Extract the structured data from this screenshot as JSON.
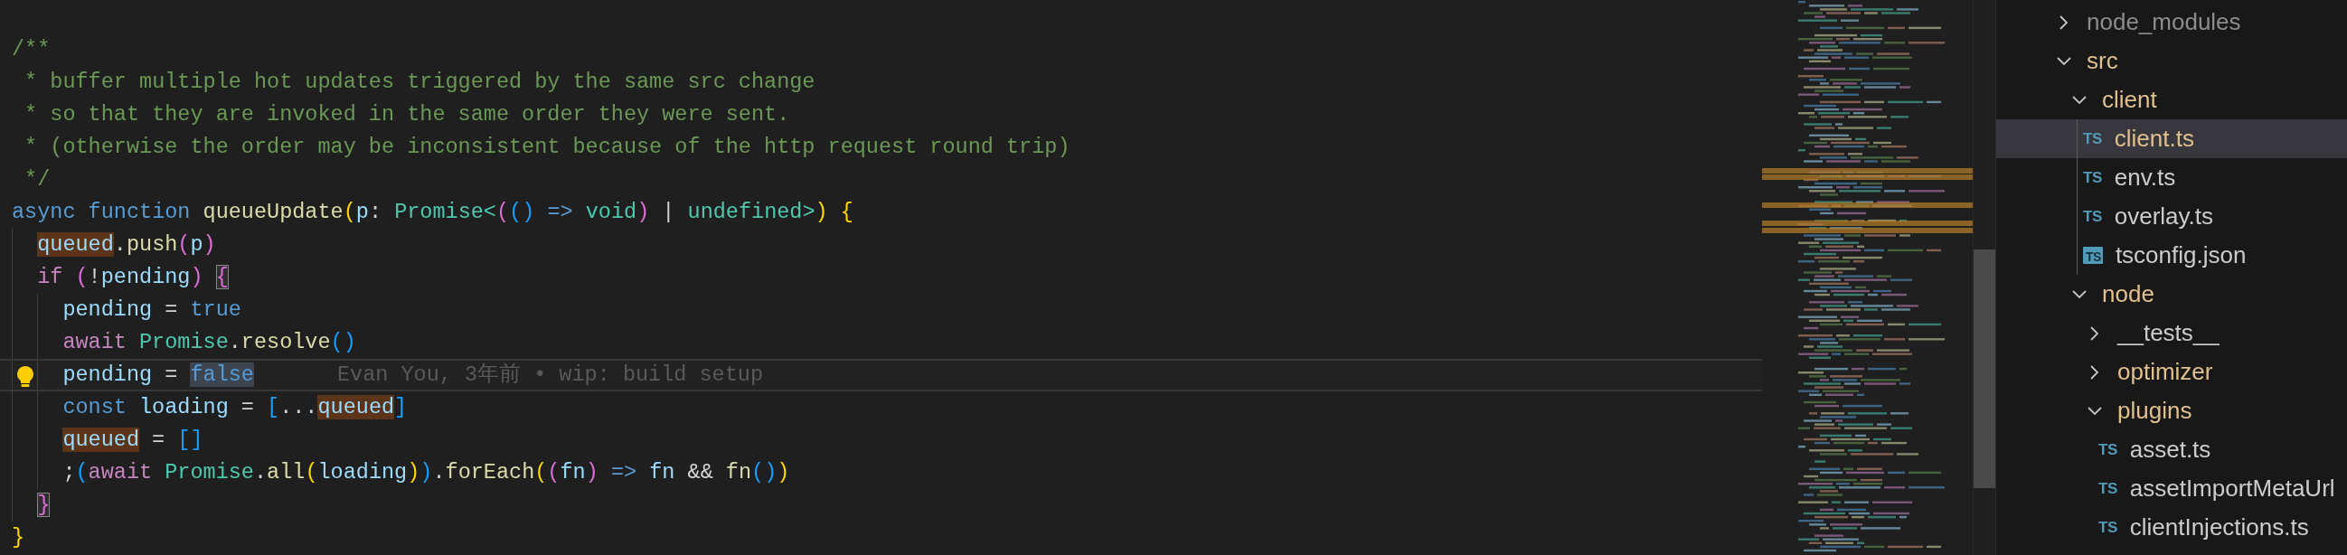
{
  "editor": {
    "lines": [
      {
        "current": false,
        "tokens": [
          {
            "text": "/**",
            "kind": "comment"
          }
        ]
      },
      {
        "current": false,
        "tokens": [
          {
            "text": " * buffer multiple hot updates triggered by the same src change",
            "kind": "comment"
          }
        ]
      },
      {
        "current": false,
        "tokens": [
          {
            "text": " * so that they are invoked in the same order they were sent.",
            "kind": "comment"
          }
        ]
      },
      {
        "current": false,
        "tokens": [
          {
            "text": " * (otherwise the order may be inconsistent because of the http request round trip)",
            "kind": "comment"
          }
        ]
      },
      {
        "current": false,
        "tokens": [
          {
            "text": " */",
            "kind": "comment"
          }
        ]
      },
      {
        "current": false,
        "tokens": [
          {
            "text": "async function ",
            "kind": "keyword"
          },
          {
            "text": "queueUpdate",
            "kind": "function"
          },
          {
            "text": "(",
            "kind": "bracket1"
          },
          {
            "text": "p",
            "kind": "variable"
          },
          {
            "text": ": ",
            "kind": "plain"
          },
          {
            "text": "Promise<",
            "kind": "type"
          },
          {
            "text": "(",
            "kind": "bracket2"
          },
          {
            "text": "()",
            "kind": "bracket3"
          },
          {
            "text": " => ",
            "kind": "keyword"
          },
          {
            "text": "void",
            "kind": "type"
          },
          {
            "text": ")",
            "kind": "bracket2"
          },
          {
            "text": " | ",
            "kind": "plain"
          },
          {
            "text": "undefined>",
            "kind": "type"
          },
          {
            "text": ")",
            "kind": "bracket1"
          },
          {
            "text": " {",
            "kind": "bracket1"
          }
        ],
        "children": [
          {
            "current": false,
            "tokens": [
              {
                "text": "queued",
                "kind": "variable",
                "highlight": true
              },
              {
                "text": ".",
                "kind": "plain"
              },
              {
                "text": "push",
                "kind": "function"
              },
              {
                "text": "(",
                "kind": "bracket2"
              },
              {
                "text": "p",
                "kind": "variable"
              },
              {
                "text": ")",
                "kind": "bracket2"
              }
            ]
          },
          {
            "current": false,
            "tokens": [
              {
                "text": "if ",
                "kind": "control"
              },
              {
                "text": "(",
                "kind": "bracket2"
              },
              {
                "text": "!",
                "kind": "plain"
              },
              {
                "text": "pending",
                "kind": "variable"
              },
              {
                "text": ") ",
                "kind": "bracket2"
              },
              {
                "text": "{",
                "kind": "bracket2",
                "match": true
              }
            ],
            "children": [
              {
                "current": false,
                "tokens": [
                  {
                    "text": "pending",
                    "kind": "variable"
                  },
                  {
                    "text": " = ",
                    "kind": "plain"
                  },
                  {
                    "text": "true",
                    "kind": "keyword"
                  }
                ]
              },
              {
                "current": false,
                "tokens": [
                  {
                    "text": "await ",
                    "kind": "control"
                  },
                  {
                    "text": "Promise",
                    "kind": "type"
                  },
                  {
                    "text": ".",
                    "kind": "plain"
                  },
                  {
                    "text": "resolve",
                    "kind": "function"
                  },
                  {
                    "text": "()",
                    "kind": "bracket3"
                  }
                ]
              },
              {
                "current": true,
                "lightbulb": true,
                "blame": "Evan You, 3年前 • wip: build setup",
                "tokens": [
                  {
                    "text": "pending",
                    "kind": "variable"
                  },
                  {
                    "text": " = ",
                    "kind": "plain"
                  },
                  {
                    "text": "false",
                    "kind": "keyword",
                    "selection": true
                  }
                ]
              },
              {
                "current": false,
                "tokens": [
                  {
                    "text": "const ",
                    "kind": "keyword"
                  },
                  {
                    "text": "loading",
                    "kind": "variable"
                  },
                  {
                    "text": " = ",
                    "kind": "plain"
                  },
                  {
                    "text": "[",
                    "kind": "bracket3"
                  },
                  {
                    "text": "...",
                    "kind": "plain"
                  },
                  {
                    "text": "queued",
                    "kind": "variable",
                    "highlight": true
                  },
                  {
                    "text": "]",
                    "kind": "bracket3"
                  }
                ]
              },
              {
                "current": false,
                "tokens": [
                  {
                    "text": "queued",
                    "kind": "variable",
                    "highlight": true
                  },
                  {
                    "text": " = ",
                    "kind": "plain"
                  },
                  {
                    "text": "[]",
                    "kind": "bracket3"
                  }
                ]
              },
              {
                "current": false,
                "tokens": [
                  {
                    "text": ";",
                    "kind": "plain"
                  },
                  {
                    "text": "(",
                    "kind": "bracket3"
                  },
                  {
                    "text": "await ",
                    "kind": "control"
                  },
                  {
                    "text": "Promise",
                    "kind": "type"
                  },
                  {
                    "text": ".",
                    "kind": "plain"
                  },
                  {
                    "text": "all",
                    "kind": "function"
                  },
                  {
                    "text": "(",
                    "kind": "bracket1"
                  },
                  {
                    "text": "loading",
                    "kind": "variable"
                  },
                  {
                    "text": ")",
                    "kind": "bracket1"
                  },
                  {
                    "text": ")",
                    "kind": "bracket3"
                  },
                  {
                    "text": ".",
                    "kind": "plain"
                  },
                  {
                    "text": "forEach",
                    "kind": "function"
                  },
                  {
                    "text": "(",
                    "kind": "bracket1"
                  },
                  {
                    "text": "(",
                    "kind": "bracket2"
                  },
                  {
                    "text": "fn",
                    "kind": "variable"
                  },
                  {
                    "text": ") ",
                    "kind": "bracket2"
                  },
                  {
                    "text": "=> ",
                    "kind": "keyword"
                  },
                  {
                    "text": "fn",
                    "kind": "variable"
                  },
                  {
                    "text": " && ",
                    "kind": "plain"
                  },
                  {
                    "text": "fn",
                    "kind": "function"
                  },
                  {
                    "text": "()",
                    "kind": "bracket3"
                  },
                  {
                    "text": ")",
                    "kind": "bracket1"
                  }
                ]
              }
            ]
          },
          {
            "current": false,
            "tokens": [
              {
                "text": "}",
                "kind": "bracket2",
                "match": true
              }
            ]
          }
        ]
      },
      {
        "current": false,
        "tokens": [
          {
            "text": "}",
            "kind": "bracket1"
          }
        ]
      }
    ]
  },
  "sidebar": {
    "tree": [
      {
        "name": "node_modules",
        "kind": "folder",
        "expanded": false,
        "selected": false,
        "color": "#8c8c8c"
      },
      {
        "name": "src",
        "kind": "folder",
        "expanded": true,
        "selected": false,
        "color": "#e2c08d",
        "children": [
          {
            "name": "client",
            "kind": "folder",
            "expanded": true,
            "selected": false,
            "color": "#e2c08d",
            "children": [
              {
                "name": "client.ts",
                "kind": "ts_file",
                "icon_text": "TS",
                "selected": true,
                "color": "#e2c08d"
              },
              {
                "name": "env.ts",
                "kind": "ts_file",
                "icon_text": "TS",
                "selected": false,
                "color": "#cccccc"
              },
              {
                "name": "overlay.ts",
                "kind": "ts_file",
                "icon_text": "TS",
                "selected": false,
                "color": "#cccccc"
              },
              {
                "name": "tsconfig.json",
                "kind": "tsconfig_file",
                "icon_text": "TS",
                "selected": false,
                "color": "#cccccc"
              }
            ]
          },
          {
            "name": "node",
            "kind": "folder",
            "expanded": true,
            "selected": false,
            "color": "#e2c08d",
            "children": [
              {
                "name": "__tests__",
                "kind": "folder",
                "expanded": false,
                "selected": false,
                "color": "#cccccc"
              },
              {
                "name": "optimizer",
                "kind": "folder",
                "expanded": false,
                "selected": false,
                "color": "#e2c08d"
              },
              {
                "name": "plugins",
                "kind": "folder",
                "expanded": true,
                "selected": false,
                "color": "#e2c08d",
                "children": [
                  {
                    "name": "asset.ts",
                    "kind": "ts_file",
                    "icon_text": "TS",
                    "selected": false,
                    "color": "#cccccc"
                  },
                  {
                    "name": "assetImportMetaUrl",
                    "kind": "ts_file",
                    "icon_text": "TS",
                    "selected": false,
                    "color": "#cccccc"
                  },
                  {
                    "name": "clientInjections.ts",
                    "kind": "ts_file",
                    "icon_text": "TS",
                    "selected": false,
                    "color": "#cccccc"
                  }
                ]
              }
            ]
          }
        ]
      }
    ]
  }
}
